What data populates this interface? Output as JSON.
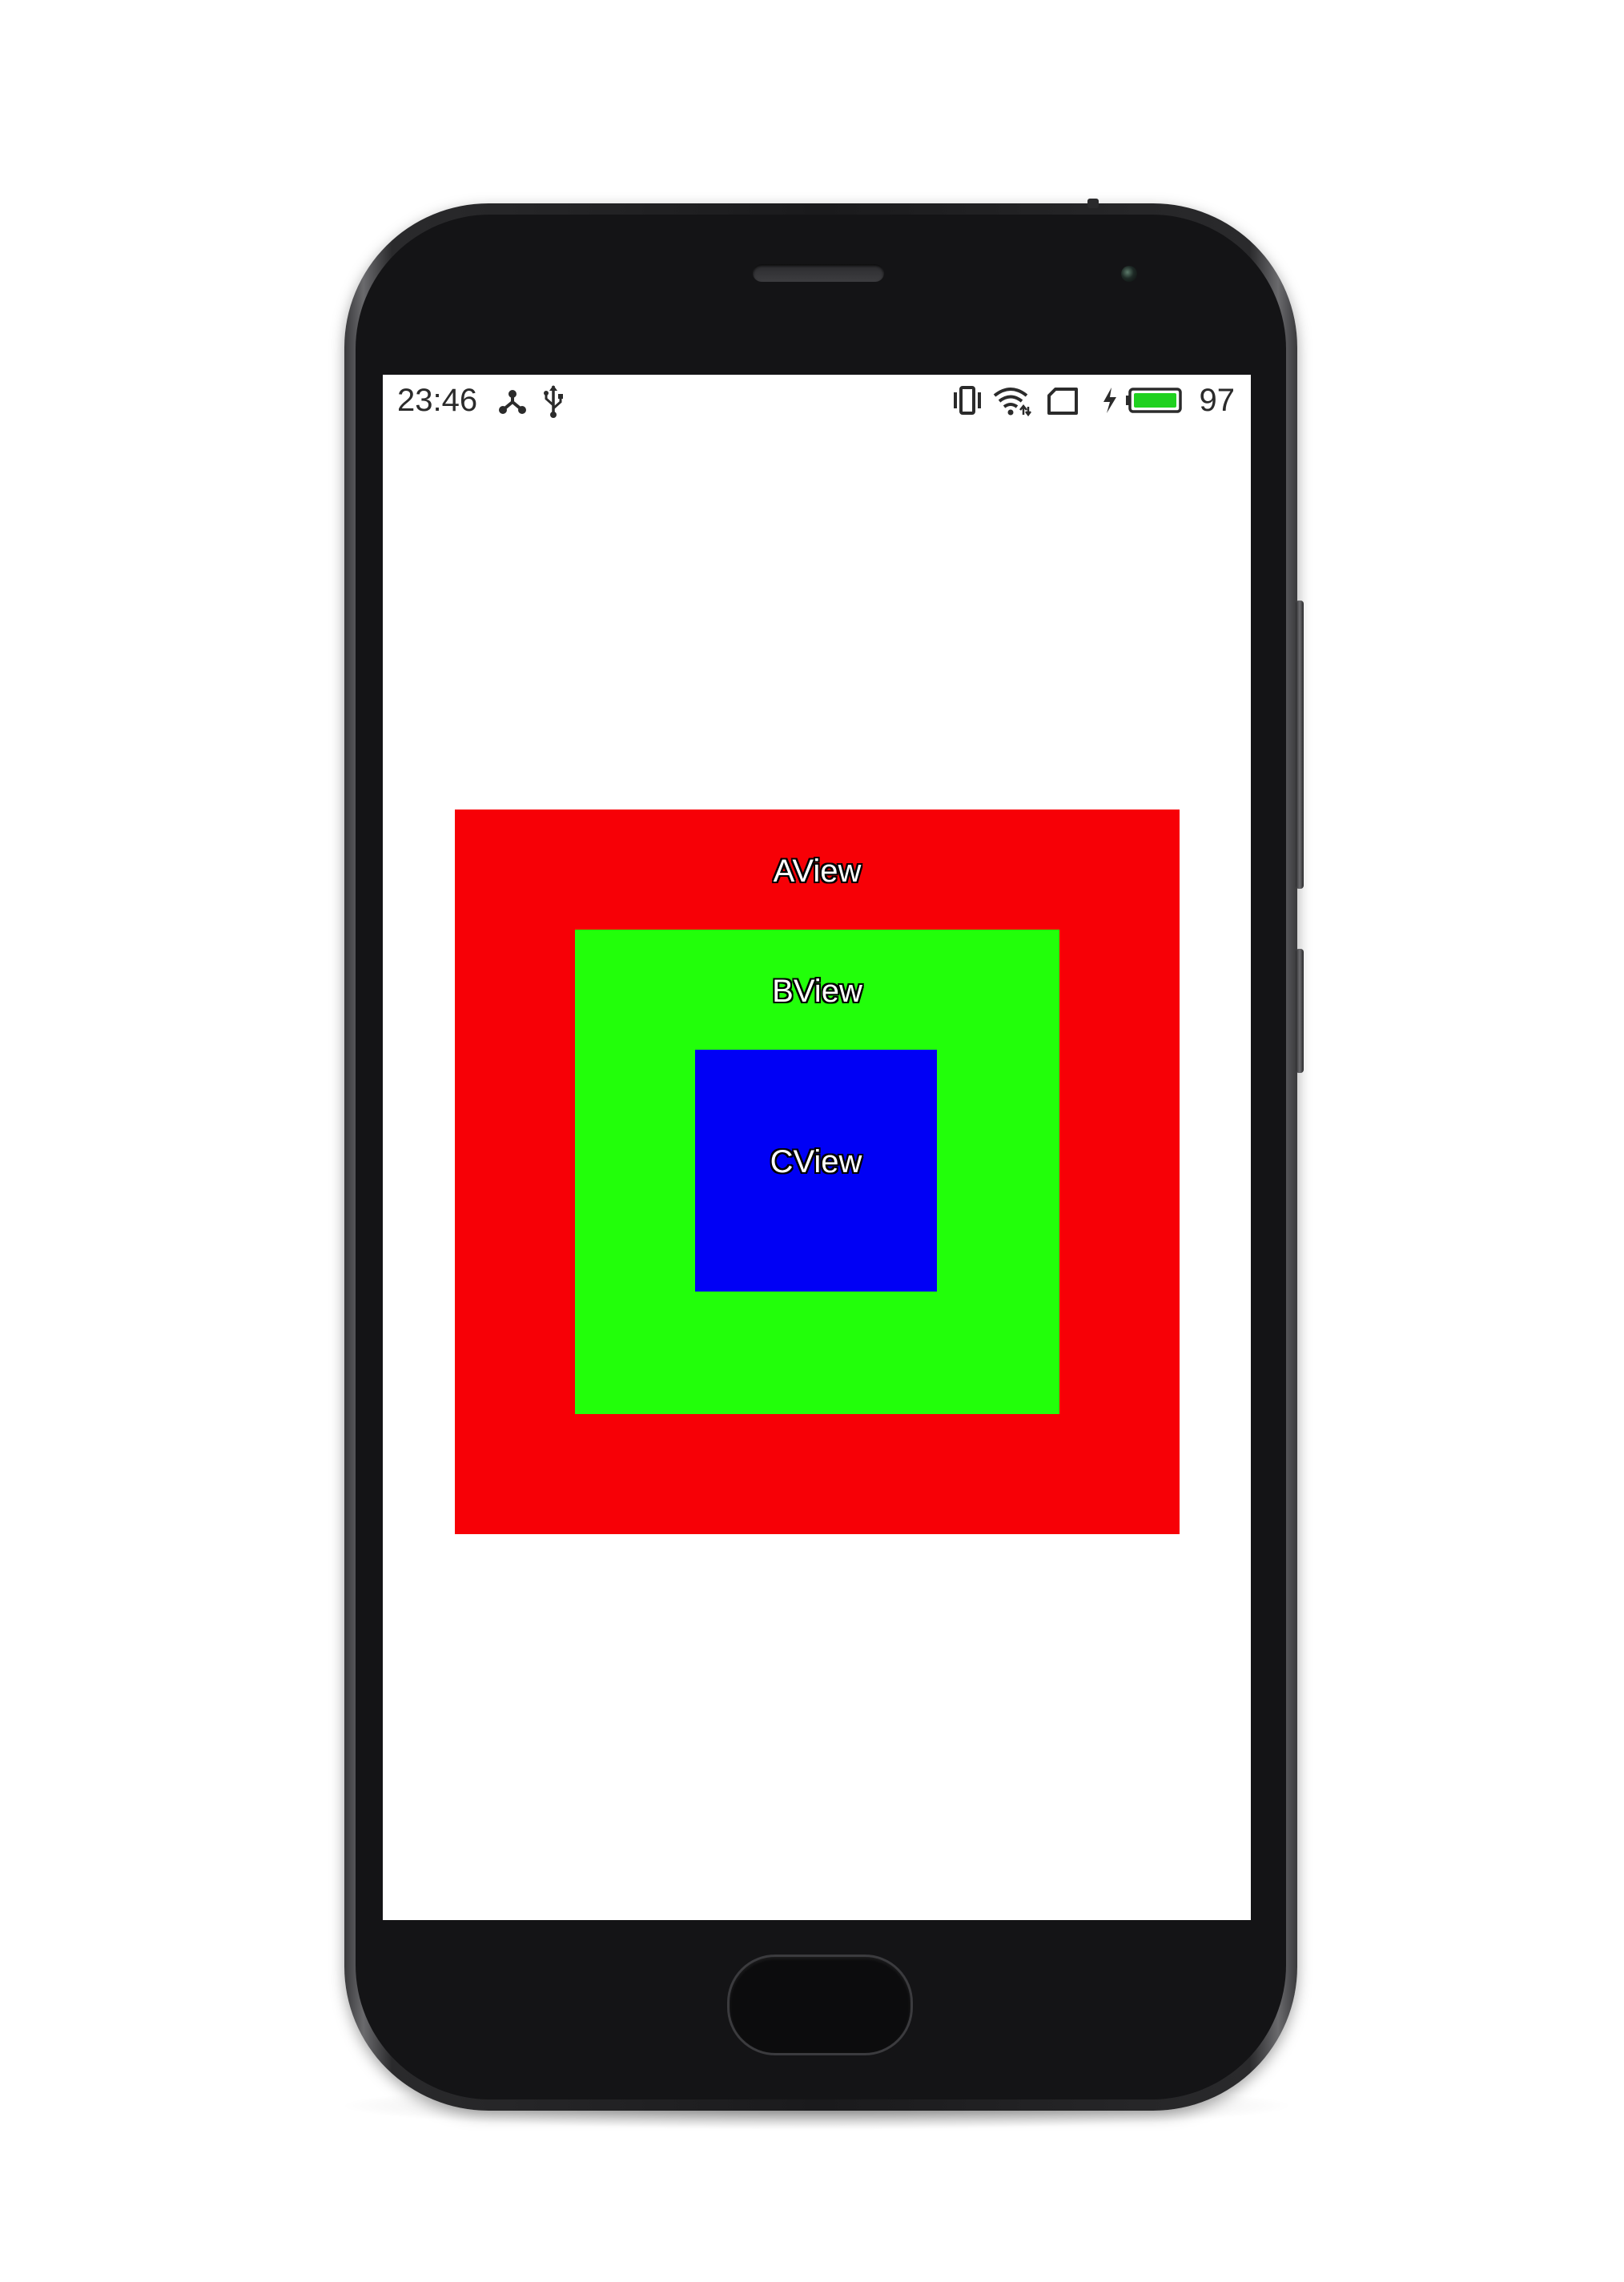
{
  "status_bar": {
    "time": "23:46",
    "left_icons": [
      "share-network-icon",
      "usb-icon"
    ],
    "right_icons": [
      "vibrate-icon",
      "wifi-icon",
      "sim-card-icon",
      "charging-bolt-icon",
      "battery-icon"
    ],
    "battery_percent": "97",
    "battery_color": "#1fd11f"
  },
  "views": {
    "a": {
      "label": "AView",
      "color": "#f70006"
    },
    "b": {
      "label": "BView",
      "color": "#22ff0a"
    },
    "c": {
      "label": "CView",
      "color": "#0000f5"
    }
  }
}
